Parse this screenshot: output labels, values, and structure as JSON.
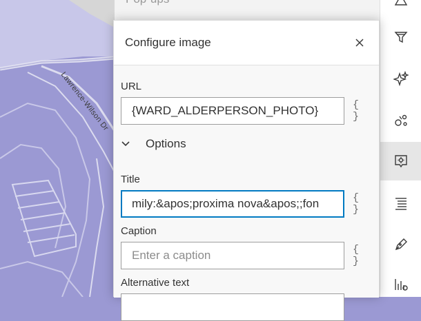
{
  "background_panel": {
    "title": "Pop-ups"
  },
  "map": {
    "road_label": "Lawrence-Wilson Dr"
  },
  "dialog": {
    "title": "Configure image",
    "fields": {
      "url": {
        "label": "URL",
        "value": "{WARD_ALDERPERSON_PHOTO}"
      },
      "options": {
        "label": "Options"
      },
      "title": {
        "label": "Title",
        "value": "mily:&apos;proxima nova&apos;;fon"
      },
      "caption": {
        "label": "Caption",
        "value": "",
        "placeholder": "Enter a caption"
      },
      "alt_text": {
        "label": "Alternative text"
      }
    },
    "expression_button": "{ }"
  },
  "toolbar": {
    "icons": [
      "shapes-icon",
      "filter-icon",
      "sparkle-icon",
      "clustering-icon",
      "popup-config-icon",
      "fields-list-icon",
      "pen-icon",
      "charts-icon"
    ],
    "active": "popup-config-icon"
  },
  "colors": {
    "map_fill": "#9b99d3",
    "map_light": "#c7c6e8",
    "accent": "#007ac2"
  }
}
